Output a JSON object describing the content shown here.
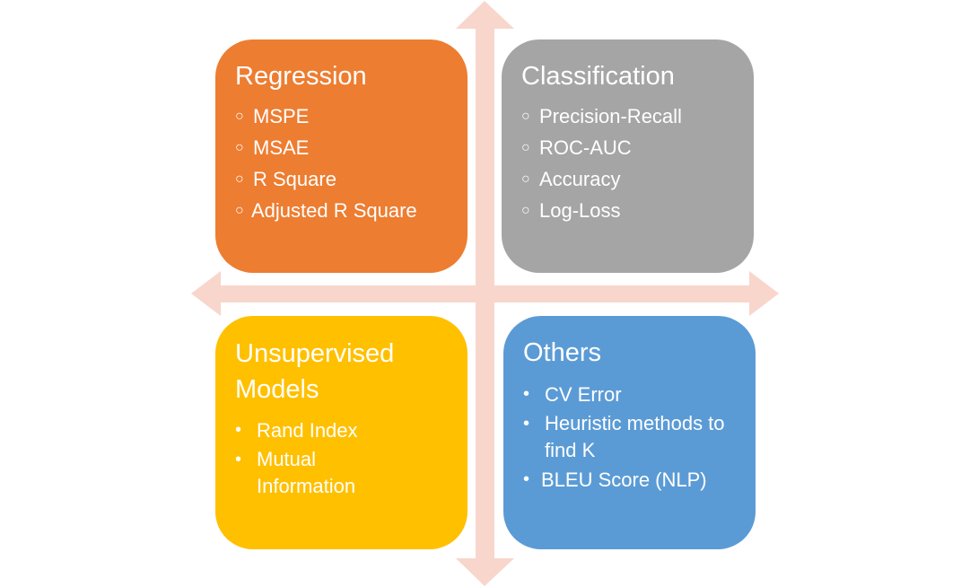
{
  "colors": {
    "arrow": "#f8d6cc",
    "regression": "#ed7d31",
    "classification": "#a5a5a5",
    "unsupervised": "#ffc000",
    "others": "#5b9bd5",
    "text": "#ffffff"
  },
  "quadrants": {
    "regression": {
      "title": "Regression",
      "marker": "○",
      "items": [
        "MSPE",
        "MSAE",
        "R Square",
        "Adjusted R Square"
      ]
    },
    "classification": {
      "title": "Classification",
      "marker": "○",
      "items": [
        "Precision-Recall",
        "ROC-AUC",
        "Accuracy",
        "Log-Loss"
      ]
    },
    "unsupervised": {
      "title_line1": "Unsupervised",
      "title_line2": "Models",
      "marker": "•",
      "items": [
        "Rand Index",
        "Mutual Information"
      ]
    },
    "others": {
      "title": "Others",
      "marker": "•",
      "items": [
        "CV Error",
        "Heuristic methods to find K",
        "BLEU Score (NLP)"
      ]
    }
  },
  "arrows": [
    "arrow-up",
    "arrow-down",
    "arrow-left",
    "arrow-right"
  ]
}
